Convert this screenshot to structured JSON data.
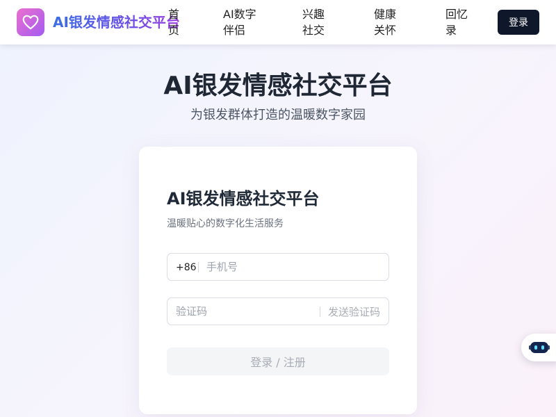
{
  "header": {
    "brand": "AI银发情感社交平台",
    "logo_icon": "heart-icon",
    "nav": [
      {
        "label": "首\n页"
      },
      {
        "label": "AI数字\n伴侣"
      },
      {
        "label": "兴趣\n社交"
      },
      {
        "label": "健康\n关怀"
      },
      {
        "label": "回忆\n录"
      }
    ],
    "login_label": "登录"
  },
  "hero": {
    "title": "AI银发情感社交平台",
    "subtitle": "为银发群体打造的温暖数字家园"
  },
  "login_card": {
    "title": "AI银发情感社交平台",
    "subtitle": "温暖贴心的数字化生活服务",
    "phone_prefix": "+86",
    "phone_placeholder": "手机号",
    "code_placeholder": "验证码",
    "send_code_label": "发送验证码",
    "submit_label": "登录 / 注册"
  },
  "floating_assistant": {
    "icon": "robot-icon"
  },
  "colors": {
    "brand_gradient_start": "#3b6fe6",
    "brand_gradient_end": "#9b3fe0",
    "logo_gradient_start": "#ec6fcf",
    "logo_gradient_end": "#a35cf0",
    "login_button_bg": "#0f172a"
  }
}
